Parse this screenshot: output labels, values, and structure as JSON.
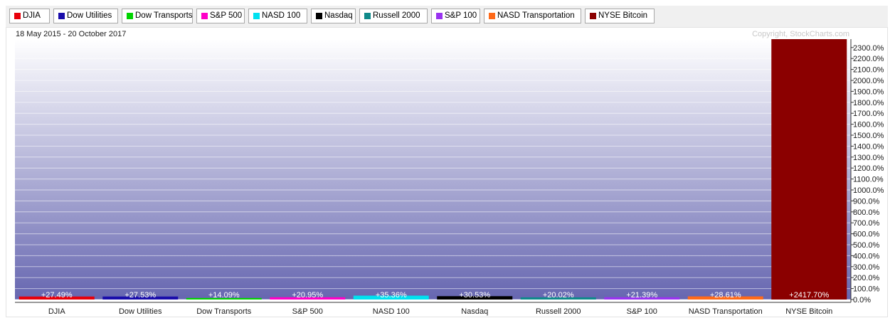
{
  "legend": [
    {
      "label": "DJIA",
      "color": "#e8000b"
    },
    {
      "label": "Dow Utilities",
      "color": "#1a0dab"
    },
    {
      "label": "Dow Transports",
      "color": "#00d400"
    },
    {
      "label": "S&P 500",
      "color": "#ff00c8"
    },
    {
      "label": "NASD 100",
      "color": "#00e1f0"
    },
    {
      "label": "Nasdaq",
      "color": "#000000"
    },
    {
      "label": "Russell 2000",
      "color": "#0f8a8a"
    },
    {
      "label": "S&P 100",
      "color": "#9a33f0"
    },
    {
      "label": "NASD Transportation",
      "color": "#ff6a1a"
    },
    {
      "label": "NYSE Bitcoin",
      "color": "#8b0000"
    }
  ],
  "date_range": "18 May 2015 - 20 October 2017",
  "copyright": "Copyright, StockCharts.com",
  "chart_data": {
    "type": "bar",
    "categories": [
      "DJIA",
      "Dow Utilities",
      "Dow Transports",
      "S&P 500",
      "NASD 100",
      "Nasdaq",
      "Russell 2000",
      "S&P 100",
      "NASD Transportation",
      "NYSE Bitcoin"
    ],
    "values": [
      27.49,
      27.53,
      14.09,
      20.95,
      35.36,
      30.53,
      20.02,
      21.39,
      28.61,
      2417.7
    ],
    "value_labels": [
      "+27.49%",
      "+27.53%",
      "+14.09%",
      "+20.95%",
      "+35.36%",
      "+30.53%",
      "+20.02%",
      "+21.39%",
      "+28.61%",
      "+2417.70%"
    ],
    "colors": [
      "#e8000b",
      "#1a0dab",
      "#00d400",
      "#ff00c8",
      "#00e1f0",
      "#000000",
      "#0f8a8a",
      "#9a33f0",
      "#ff6a1a",
      "#8b0000"
    ],
    "yticks": [
      "0.0%",
      "100.0%",
      "200.0%",
      "300.0%",
      "400.0%",
      "500.0%",
      "600.0%",
      "700.0%",
      "800.0%",
      "900.0%",
      "1000.0%",
      "1100.0%",
      "1200.0%",
      "1300.0%",
      "1400.0%",
      "1500.0%",
      "1600.0%",
      "1700.0%",
      "1800.0%",
      "1900.0%",
      "2000.0%",
      "2100.0%",
      "2200.0%",
      "2300.0%"
    ],
    "ylim": [
      0,
      2300
    ],
    "y_axis_position": "right",
    "grid": true,
    "background_gradient": [
      "#ffffff",
      "#6666b0"
    ]
  }
}
